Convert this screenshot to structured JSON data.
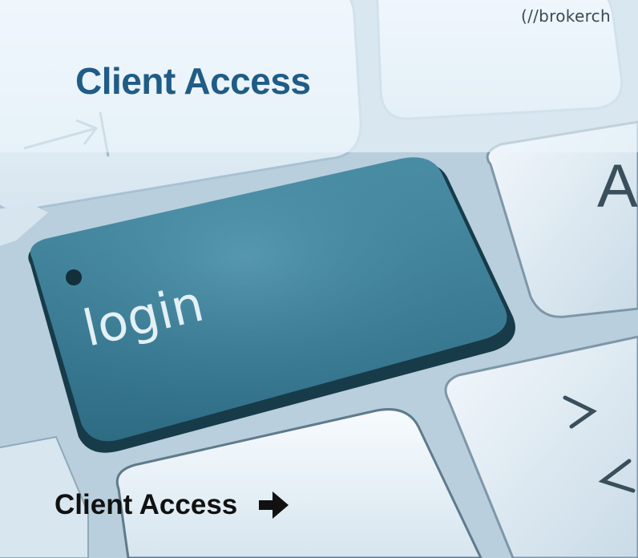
{
  "header": {
    "url_text": "(//brokerch",
    "title": "Client Access"
  },
  "hero": {
    "key_label": "login",
    "key_symbols": [
      "A",
      ">",
      "<"
    ]
  },
  "cta": {
    "label": "Client Access",
    "icon": "arrow-right-icon"
  },
  "colors": {
    "title": "#1f5c86",
    "login_key": "#3d8098",
    "cta_text": "#111111"
  }
}
